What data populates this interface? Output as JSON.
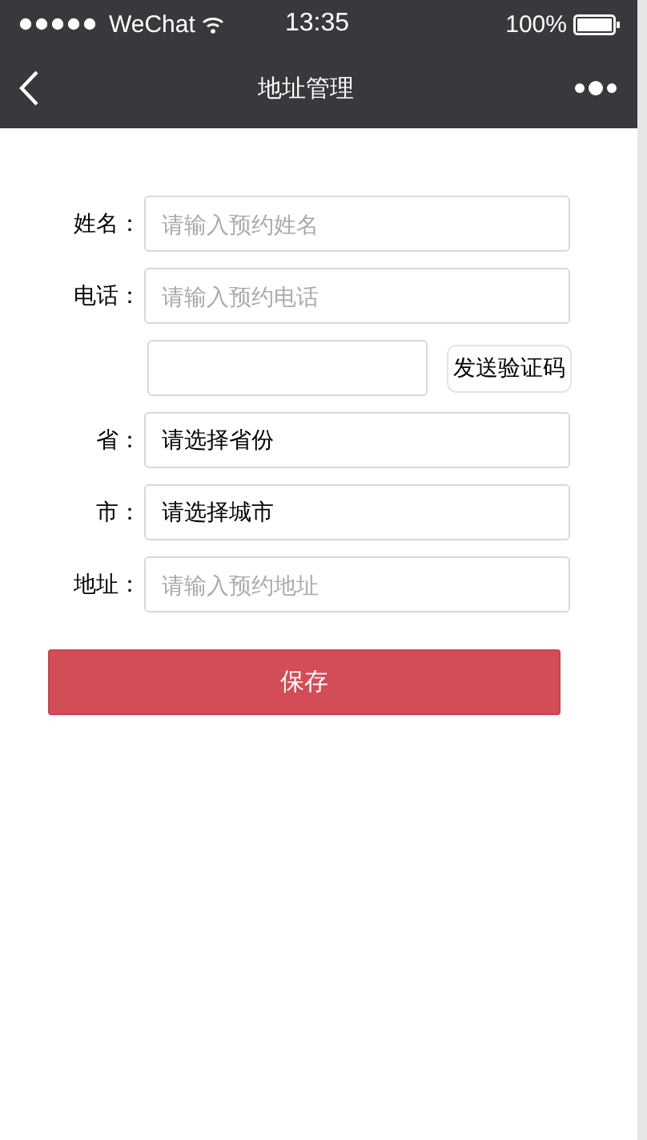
{
  "status_bar": {
    "carrier": "WeChat",
    "time": "13:35",
    "battery": "100%"
  },
  "nav": {
    "title": "地址管理"
  },
  "form": [
    {
      "kind": "input",
      "label": "姓名：",
      "placeholder": "请输入预约姓名"
    },
    {
      "kind": "input",
      "label": "电话：",
      "placeholder": "请输入预约电话"
    },
    {
      "kind": "code",
      "button": "发送验证码"
    },
    {
      "kind": "select",
      "label": "省：",
      "value": "请选择省份"
    },
    {
      "kind": "select",
      "label": "市：",
      "value": "请选择城市"
    },
    {
      "kind": "input",
      "label": "地址：",
      "placeholder": "请输入预约地址"
    }
  ],
  "save_button": "保存"
}
